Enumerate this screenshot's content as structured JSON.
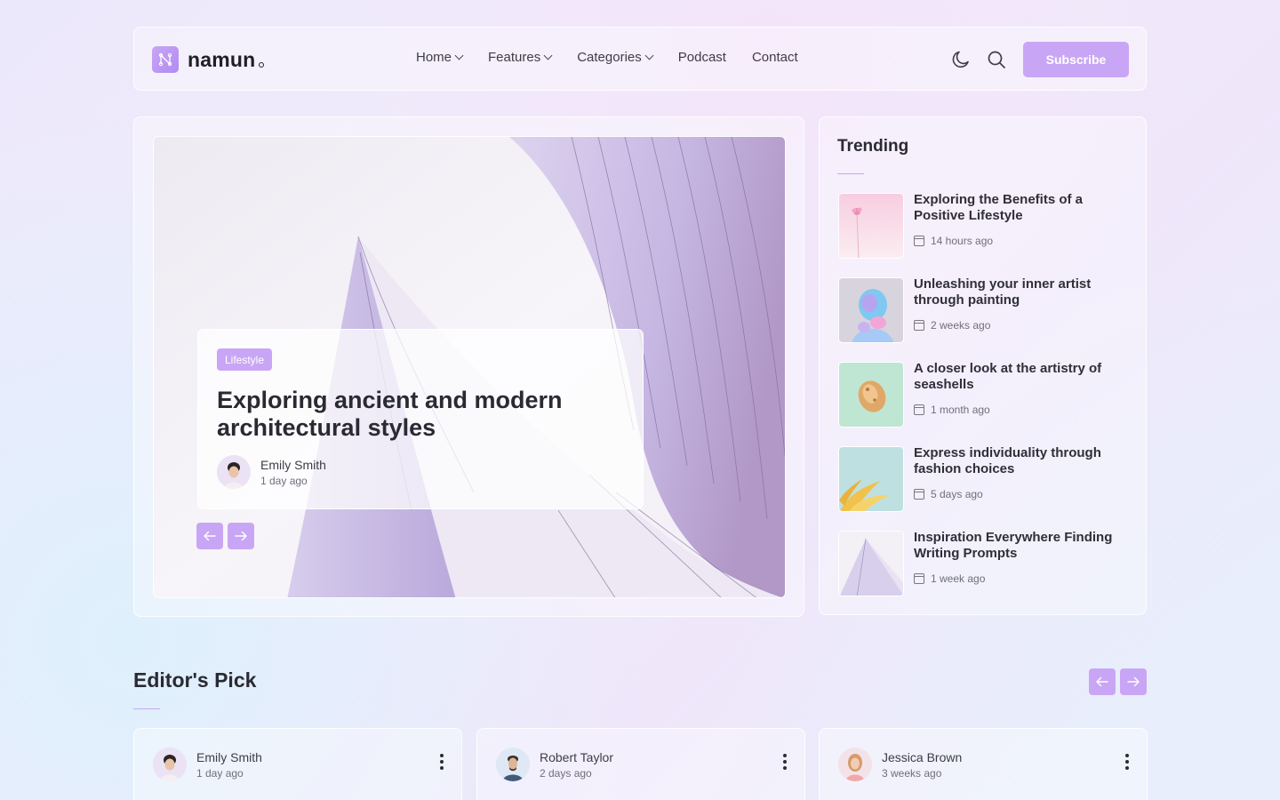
{
  "brand": {
    "name": "namun",
    "logo_icon": "monogram-n-icon"
  },
  "nav": {
    "items": [
      {
        "label": "Home",
        "has_dropdown": true
      },
      {
        "label": "Features",
        "has_dropdown": true
      },
      {
        "label": "Categories",
        "has_dropdown": true
      },
      {
        "label": "Podcast",
        "has_dropdown": false
      },
      {
        "label": "Contact",
        "has_dropdown": false
      }
    ],
    "subscribe_label": "Subscribe"
  },
  "hero": {
    "tag": "Lifestyle",
    "title": "Exploring ancient and modern architectural styles",
    "author": "Emily Smith",
    "time": "1 day ago"
  },
  "trending": {
    "title": "Trending",
    "items": [
      {
        "title": "Exploring the Benefits of a Positive Lifestyle",
        "time": "14 hours ago"
      },
      {
        "title": "Unleashing your inner artist through painting",
        "time": "2 weeks ago"
      },
      {
        "title": "A closer look at the artistry of seashells",
        "time": "1 month ago"
      },
      {
        "title": "Express individuality through fashion choices",
        "time": "5 days ago"
      },
      {
        "title": "Inspiration Everywhere Finding Writing Prompts",
        "time": "1 week ago"
      }
    ]
  },
  "editors_pick": {
    "title": "Editor's Pick",
    "cards": [
      {
        "author": "Emily Smith",
        "time": "1 day ago"
      },
      {
        "author": "Robert Taylor",
        "time": "2 days ago"
      },
      {
        "author": "Jessica Brown",
        "time": "3 weeks ago"
      }
    ]
  },
  "colors": {
    "accent": "#c9a6f5",
    "text": "#2a2a33",
    "muted": "#6f6f7a"
  }
}
